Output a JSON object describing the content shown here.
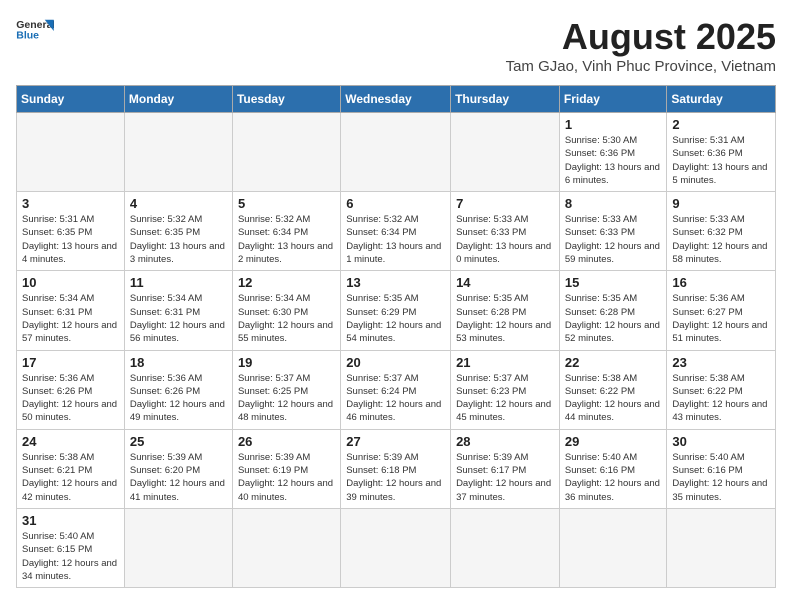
{
  "header": {
    "logo_general": "General",
    "logo_blue": "Blue",
    "title": "August 2025",
    "subtitle": "Tam GJao, Vinh Phuc Province, Vietnam"
  },
  "weekdays": [
    "Sunday",
    "Monday",
    "Tuesday",
    "Wednesday",
    "Thursday",
    "Friday",
    "Saturday"
  ],
  "weeks": [
    [
      {
        "day": "",
        "info": ""
      },
      {
        "day": "",
        "info": ""
      },
      {
        "day": "",
        "info": ""
      },
      {
        "day": "",
        "info": ""
      },
      {
        "day": "",
        "info": ""
      },
      {
        "day": "1",
        "info": "Sunrise: 5:30 AM\nSunset: 6:36 PM\nDaylight: 13 hours and 6 minutes."
      },
      {
        "day": "2",
        "info": "Sunrise: 5:31 AM\nSunset: 6:36 PM\nDaylight: 13 hours and 5 minutes."
      }
    ],
    [
      {
        "day": "3",
        "info": "Sunrise: 5:31 AM\nSunset: 6:35 PM\nDaylight: 13 hours and 4 minutes."
      },
      {
        "day": "4",
        "info": "Sunrise: 5:32 AM\nSunset: 6:35 PM\nDaylight: 13 hours and 3 minutes."
      },
      {
        "day": "5",
        "info": "Sunrise: 5:32 AM\nSunset: 6:34 PM\nDaylight: 13 hours and 2 minutes."
      },
      {
        "day": "6",
        "info": "Sunrise: 5:32 AM\nSunset: 6:34 PM\nDaylight: 13 hours and 1 minute."
      },
      {
        "day": "7",
        "info": "Sunrise: 5:33 AM\nSunset: 6:33 PM\nDaylight: 13 hours and 0 minutes."
      },
      {
        "day": "8",
        "info": "Sunrise: 5:33 AM\nSunset: 6:33 PM\nDaylight: 12 hours and 59 minutes."
      },
      {
        "day": "9",
        "info": "Sunrise: 5:33 AM\nSunset: 6:32 PM\nDaylight: 12 hours and 58 minutes."
      }
    ],
    [
      {
        "day": "10",
        "info": "Sunrise: 5:34 AM\nSunset: 6:31 PM\nDaylight: 12 hours and 57 minutes."
      },
      {
        "day": "11",
        "info": "Sunrise: 5:34 AM\nSunset: 6:31 PM\nDaylight: 12 hours and 56 minutes."
      },
      {
        "day": "12",
        "info": "Sunrise: 5:34 AM\nSunset: 6:30 PM\nDaylight: 12 hours and 55 minutes."
      },
      {
        "day": "13",
        "info": "Sunrise: 5:35 AM\nSunset: 6:29 PM\nDaylight: 12 hours and 54 minutes."
      },
      {
        "day": "14",
        "info": "Sunrise: 5:35 AM\nSunset: 6:28 PM\nDaylight: 12 hours and 53 minutes."
      },
      {
        "day": "15",
        "info": "Sunrise: 5:35 AM\nSunset: 6:28 PM\nDaylight: 12 hours and 52 minutes."
      },
      {
        "day": "16",
        "info": "Sunrise: 5:36 AM\nSunset: 6:27 PM\nDaylight: 12 hours and 51 minutes."
      }
    ],
    [
      {
        "day": "17",
        "info": "Sunrise: 5:36 AM\nSunset: 6:26 PM\nDaylight: 12 hours and 50 minutes."
      },
      {
        "day": "18",
        "info": "Sunrise: 5:36 AM\nSunset: 6:26 PM\nDaylight: 12 hours and 49 minutes."
      },
      {
        "day": "19",
        "info": "Sunrise: 5:37 AM\nSunset: 6:25 PM\nDaylight: 12 hours and 48 minutes."
      },
      {
        "day": "20",
        "info": "Sunrise: 5:37 AM\nSunset: 6:24 PM\nDaylight: 12 hours and 46 minutes."
      },
      {
        "day": "21",
        "info": "Sunrise: 5:37 AM\nSunset: 6:23 PM\nDaylight: 12 hours and 45 minutes."
      },
      {
        "day": "22",
        "info": "Sunrise: 5:38 AM\nSunset: 6:22 PM\nDaylight: 12 hours and 44 minutes."
      },
      {
        "day": "23",
        "info": "Sunrise: 5:38 AM\nSunset: 6:22 PM\nDaylight: 12 hours and 43 minutes."
      }
    ],
    [
      {
        "day": "24",
        "info": "Sunrise: 5:38 AM\nSunset: 6:21 PM\nDaylight: 12 hours and 42 minutes."
      },
      {
        "day": "25",
        "info": "Sunrise: 5:39 AM\nSunset: 6:20 PM\nDaylight: 12 hours and 41 minutes."
      },
      {
        "day": "26",
        "info": "Sunrise: 5:39 AM\nSunset: 6:19 PM\nDaylight: 12 hours and 40 minutes."
      },
      {
        "day": "27",
        "info": "Sunrise: 5:39 AM\nSunset: 6:18 PM\nDaylight: 12 hours and 39 minutes."
      },
      {
        "day": "28",
        "info": "Sunrise: 5:39 AM\nSunset: 6:17 PM\nDaylight: 12 hours and 37 minutes."
      },
      {
        "day": "29",
        "info": "Sunrise: 5:40 AM\nSunset: 6:16 PM\nDaylight: 12 hours and 36 minutes."
      },
      {
        "day": "30",
        "info": "Sunrise: 5:40 AM\nSunset: 6:16 PM\nDaylight: 12 hours and 35 minutes."
      }
    ],
    [
      {
        "day": "31",
        "info": "Sunrise: 5:40 AM\nSunset: 6:15 PM\nDaylight: 12 hours and 34 minutes."
      },
      {
        "day": "",
        "info": ""
      },
      {
        "day": "",
        "info": ""
      },
      {
        "day": "",
        "info": ""
      },
      {
        "day": "",
        "info": ""
      },
      {
        "day": "",
        "info": ""
      },
      {
        "day": "",
        "info": ""
      }
    ]
  ]
}
